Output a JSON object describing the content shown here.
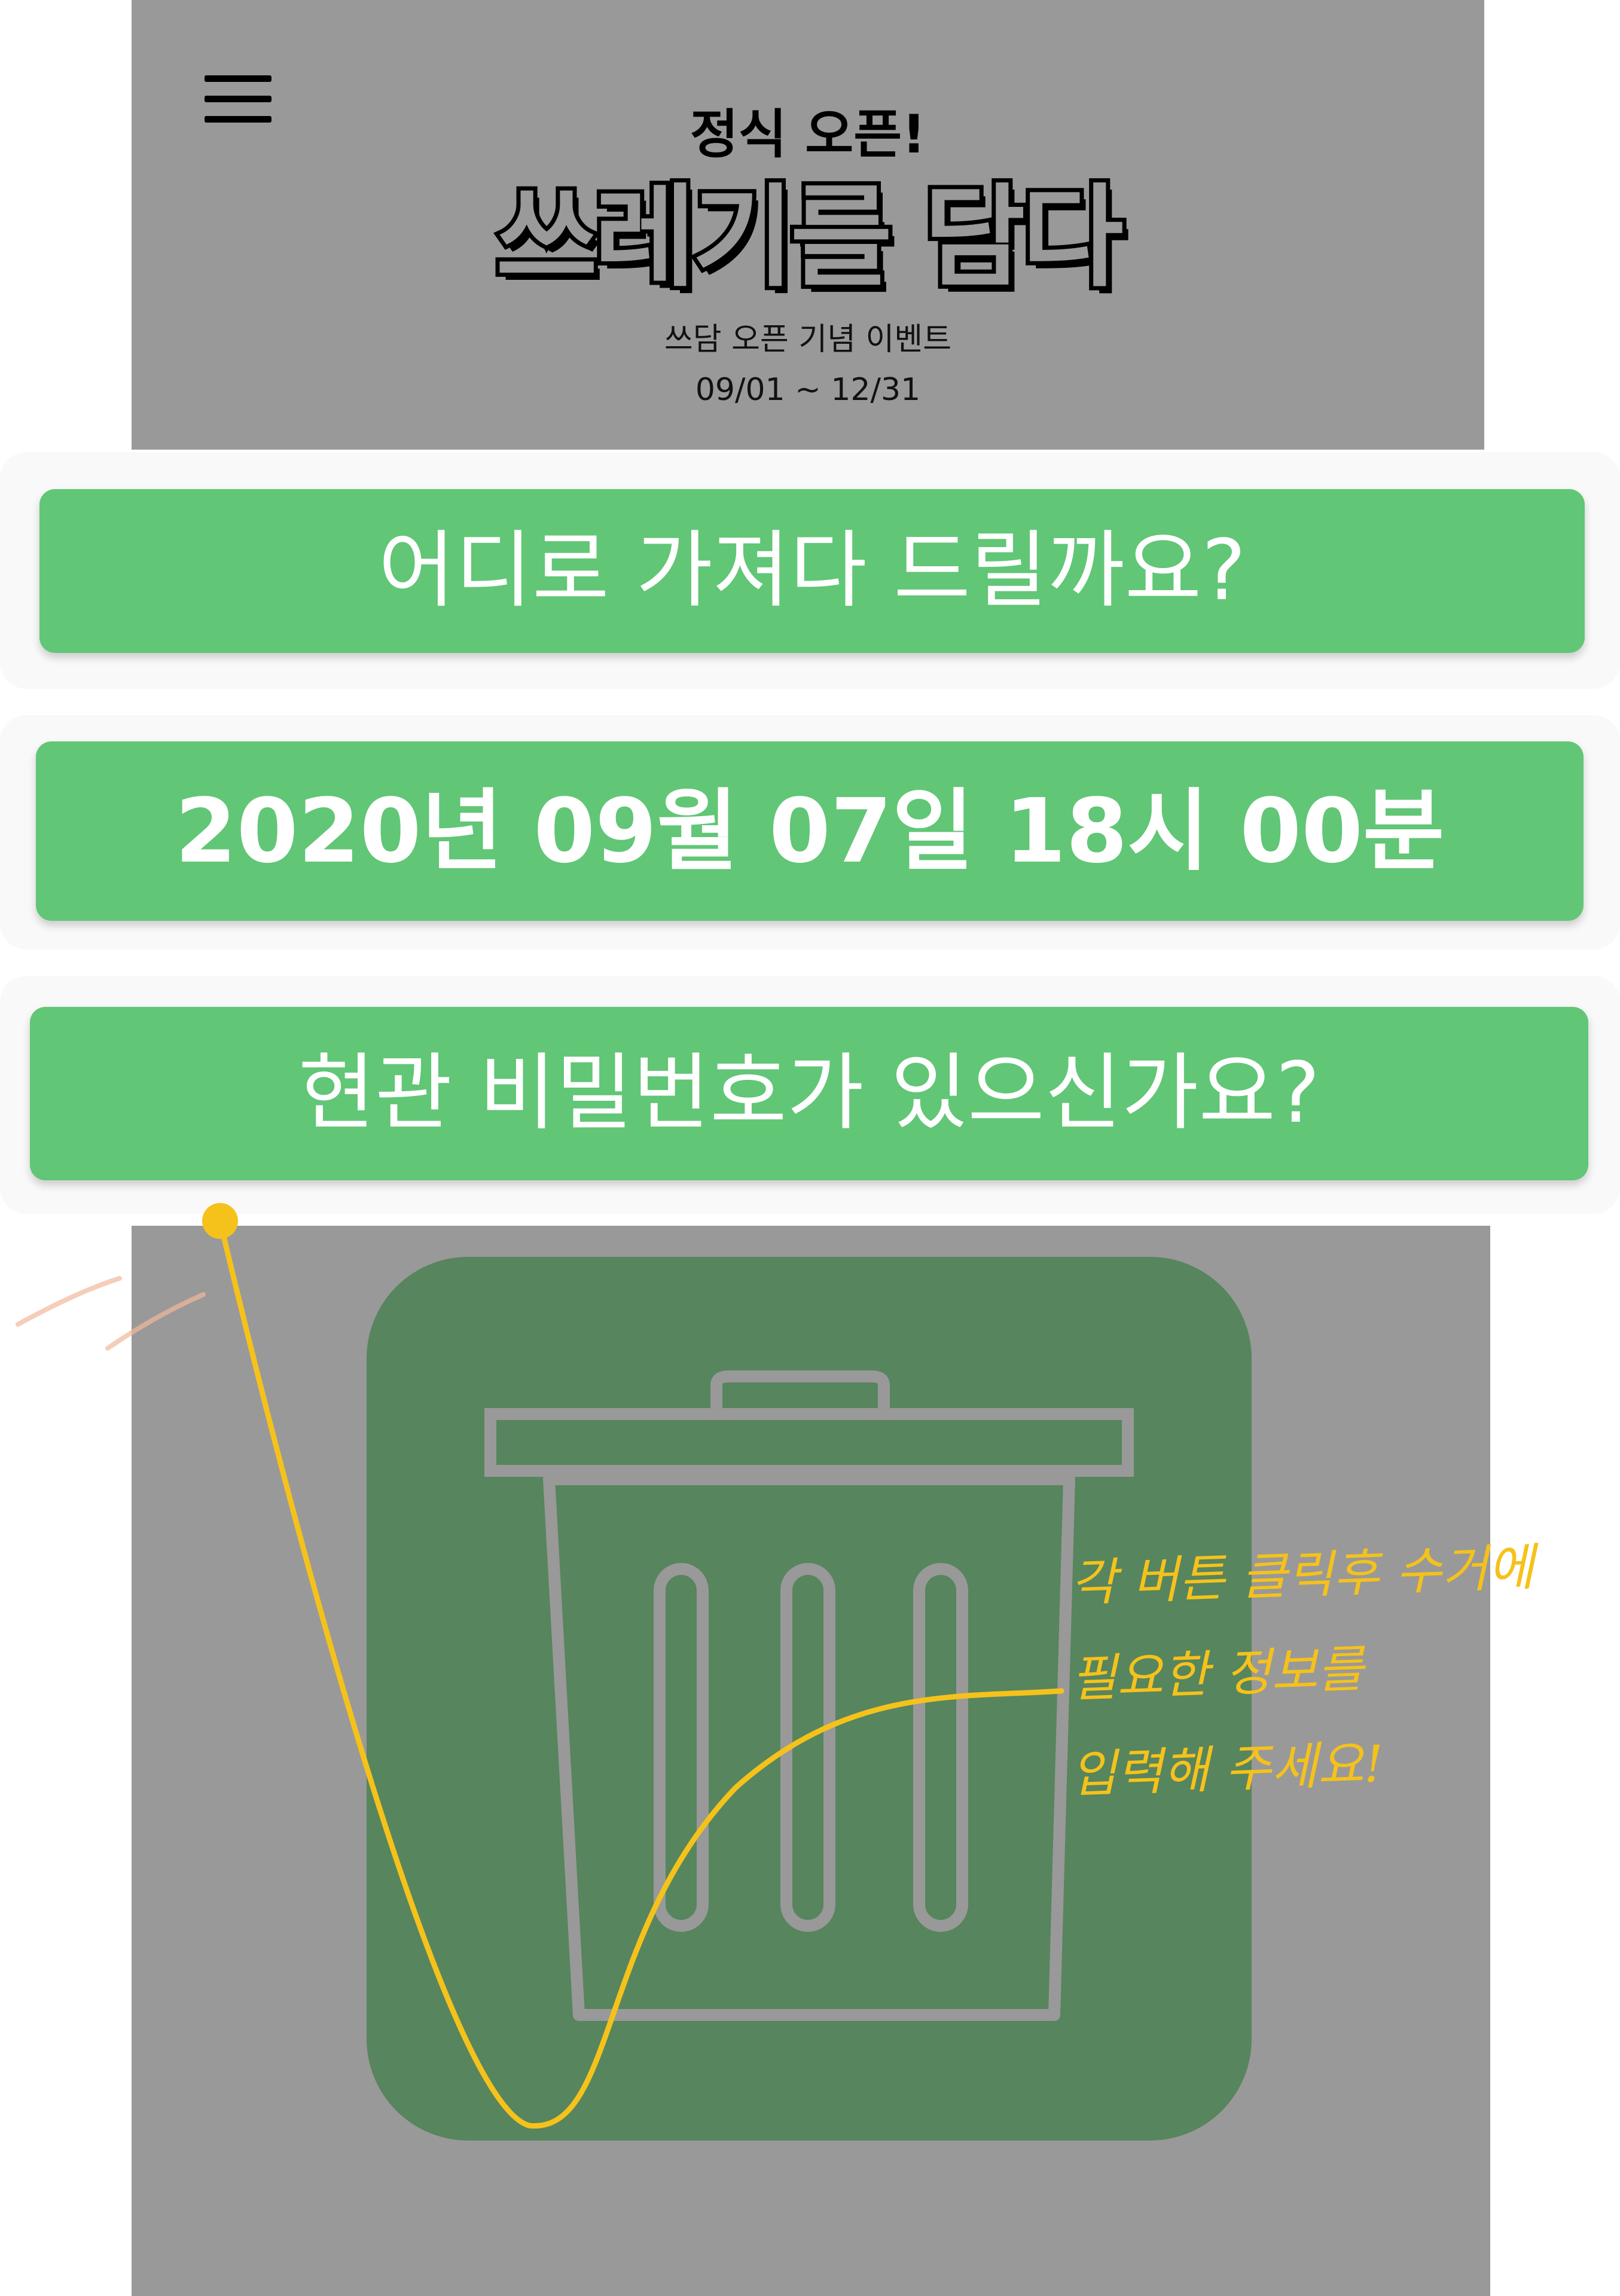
{
  "header": {
    "menu_icon": "hamburger-menu-icon",
    "kicker": "정식 오픈!",
    "logo_text": "쓰레기를 담다",
    "event_name": "쓰담 오픈 기념 이벤트",
    "event_period": "09/01 ~ 12/31"
  },
  "form": {
    "location_button": "어디로 가져다 드릴까요?",
    "datetime_button": "2020년 09월 07일 18시 00분",
    "password_button": "현관 비밀번호가 있으신가요?"
  },
  "illustration": {
    "icon": "trash-can-icon"
  },
  "annotation": {
    "lines": [
      "각 버튼 클릭후 수거에",
      "필요한 정보를",
      "입력해 주세요!"
    ]
  },
  "colors": {
    "banner_bg": "#999999",
    "button_green": "#61c676",
    "tile_green": "#57855e",
    "annotation_yellow": "#f5c21b"
  }
}
